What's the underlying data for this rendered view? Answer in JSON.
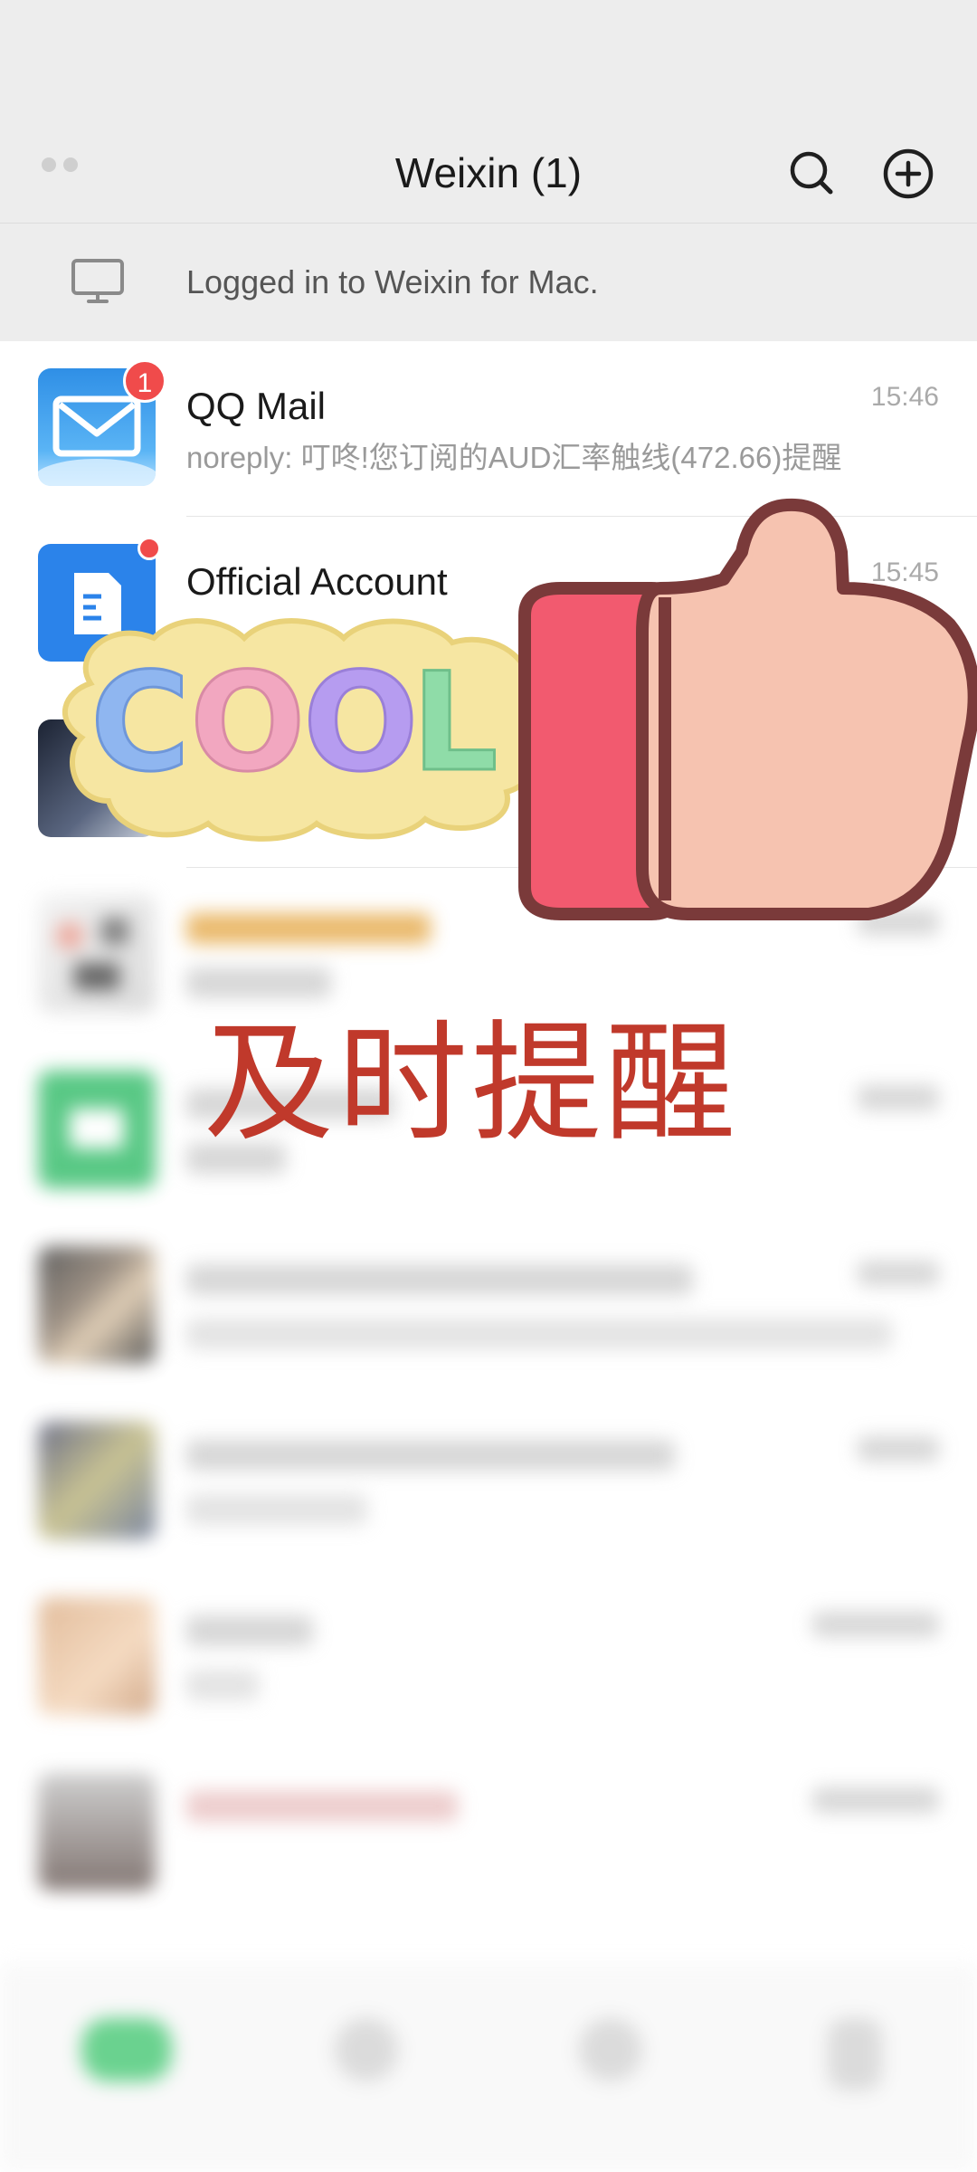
{
  "header": {
    "title": "Weixin (1)"
  },
  "login_banner": {
    "text": "Logged in to Weixin for Mac."
  },
  "chats": [
    {
      "name": "QQ Mail",
      "preview": "noreply: 叮咚!您订阅的AUD汇率触线(472.66)提醒",
      "time": "15:46",
      "badge": "1"
    },
    {
      "name": "Official Account",
      "preview": "",
      "time": "15:45"
    }
  ],
  "overlay": {
    "caption": "及时提醒",
    "sticker_text": "COOL"
  },
  "colors": {
    "badge": "#f04b4b",
    "header_bg": "#ededed",
    "caption": "#c0392b"
  }
}
